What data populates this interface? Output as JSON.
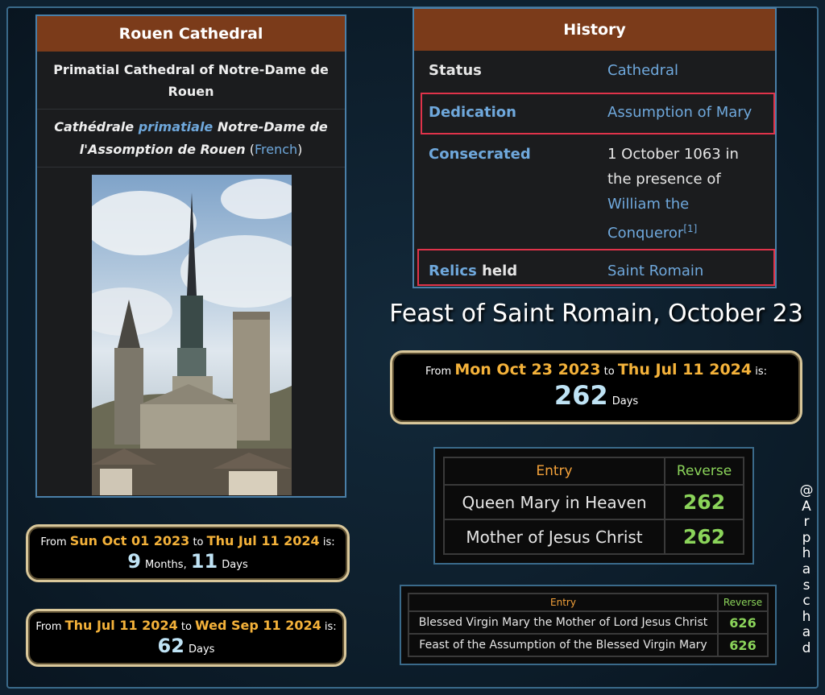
{
  "infobox": {
    "title": "Rouen Cathedral",
    "subtitle": "Primatial Cathedral of Notre-Dame de Rouen",
    "native_name_1": "Cathédrale ",
    "native_name_link": "primatiale",
    "native_name_2": " Notre-Dame de l'Assomption de Rouen",
    "lang_open": " (",
    "lang": "French",
    "lang_close": ")"
  },
  "history": {
    "title": "History",
    "rows": [
      {
        "label": "Status",
        "value": "Cathedral"
      },
      {
        "label": "Dedication",
        "value": "Assumption of Mary"
      },
      {
        "label": "Consecrated",
        "value_plain": "1 October 1063 in the presence of",
        "value_link": "William the Conqueror",
        "ref": "[1]"
      },
      {
        "label_link": "Relics",
        "label_plain": " held",
        "value": "Saint Romain"
      }
    ]
  },
  "feast_heading": "Feast of Saint Romain, October 23",
  "date_calcs": [
    {
      "from_word": "From",
      "from": "Mon Oct 23 2023",
      "to_word": "to",
      "to": "Thu Jul 11 2024",
      "is_word": "is:",
      "n1": "262",
      "u1": "Days"
    },
    {
      "from_word": "From",
      "from": "Sun Oct 01 2023",
      "to_word": "to",
      "to": "Thu Jul 11 2024",
      "is_word": "is:",
      "n1": "9",
      "u1": "Months,",
      "n2": "11",
      "u2": "Days"
    },
    {
      "from_word": "From",
      "from": "Thu Jul 11 2024",
      "to_word": "to",
      "to": "Wed Sep 11 2024",
      "is_word": "is:",
      "n1": "62",
      "u1": "Days"
    }
  ],
  "gematria_1": {
    "header_entry": "Entry",
    "header_reverse": "Reverse",
    "rows": [
      {
        "entry": "Queen Mary in Heaven",
        "value": "262"
      },
      {
        "entry": "Mother of Jesus Christ",
        "value": "262"
      }
    ]
  },
  "gematria_2": {
    "header_entry": "Entry",
    "header_reverse": "Reverse",
    "rows": [
      {
        "entry": "Blessed Virgin Mary the Mother of Lord Jesus Christ",
        "value": "626"
      },
      {
        "entry": "Feast of the Assumption of the Blessed Virgin Mary",
        "value": "626"
      }
    ]
  },
  "watermark": [
    "@",
    "A",
    "r",
    "p",
    "h",
    "a",
    "s",
    "c",
    "h",
    "a",
    "d"
  ],
  "colors": {
    "accent_orange": "#f4b23a",
    "reverse_green": "#8bd45a",
    "header_brown": "#7b3b1a",
    "highlight_red": "#e0334a"
  }
}
